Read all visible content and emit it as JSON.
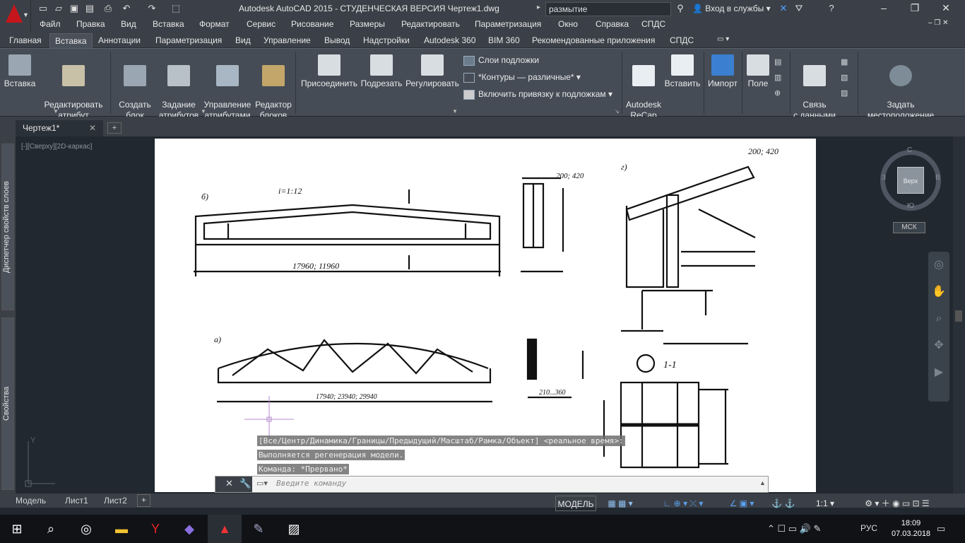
{
  "app": {
    "title": "Autodesk AutoCAD 2015 - СТУДЕНЧЕСКАЯ ВЕРСИЯ    Чертеж1.dwg",
    "search_value": "размытие",
    "signin": "Вход в службы"
  },
  "menu": [
    "Файл",
    "Правка",
    "Вид",
    "Вставка",
    "Формат",
    "Сервис",
    "Рисование",
    "Размеры",
    "Редактировать",
    "Параметризация",
    "Окно",
    "Справка",
    "СПДС"
  ],
  "ribbon_tabs": [
    "Главная",
    "Вставка",
    "Аннотации",
    "Параметризация",
    "Вид",
    "Управление",
    "Вывод",
    "Надстройки",
    "Autodesk 360",
    "BIM 360",
    "Рекомендованные приложения",
    "СПДС"
  ],
  "ribbon": {
    "insert": "Вставка",
    "edit_attr": "Редактировать\nатрибут",
    "create_block": "Создать\nблок",
    "define_attr": "Задание\nатрибутов",
    "manage_attr": "Управление\nатрибутами",
    "block_editor": "Редактор\nблоков",
    "attach": "Присоединить",
    "clip": "Подрезать",
    "adjust": "Регулировать",
    "underlay_layers": "Слои подложки",
    "contours": "*Контуры — различные*",
    "snap_underlay": "Включить привязку к подложкам",
    "recap": "Autodesk\nReCap",
    "paste": "Вставить",
    "import": "Импорт",
    "field": "Поле",
    "data_link": "Связь\nс данными",
    "set_location": "Задать\nместоположение"
  },
  "doc_tab": "Чертеж1*",
  "view_label": "[-][Сверху][2D-каркас]",
  "side_panels": [
    "Диспетчер свойств слоев",
    "Свойства"
  ],
  "navcube": {
    "top": "Верх",
    "n": "С",
    "s": "Ю",
    "w": "З",
    "e": "В",
    "ucs": "МСК"
  },
  "command_history": [
    "[Все/Центр/Динамика/Границы/Предыдущий/Масштаб/Рамка/Объект] <реальное время>:",
    "Выполняется регенерация модели.",
    "Команда: *Прервано*"
  ],
  "command_placeholder": "Введите команду",
  "layout_tabs": [
    "Модель",
    "Лист1",
    "Лист2"
  ],
  "status": {
    "model": "МОДЕЛЬ",
    "scale": "1:1"
  },
  "taskbar": {
    "lang": "РУС",
    "time": "18:09",
    "date": "07.03.2018"
  },
  "drawing_labels": {
    "slope": "i=1:12",
    "dim1": "17960; 11960",
    "dim2": "17940; 23940; 29940",
    "sec1": "200; 420",
    "sec2": "210...360",
    "section": "1-1",
    "lbl_a": "а)",
    "lbl_b": "б)",
    "lbl_g": "г)",
    "top_right": "200; 420"
  }
}
